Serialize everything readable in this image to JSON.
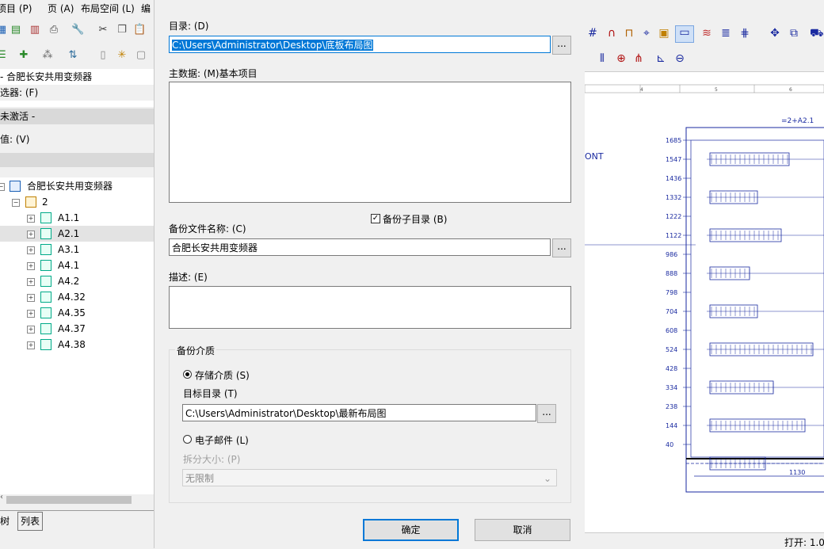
{
  "menu": {
    "items": [
      "项目 (P)",
      "页 (A)",
      "布局空间 (L)",
      "编"
    ]
  },
  "left": {
    "project_row": "- 合肥长安共用变频器",
    "filter_label": "选器: (F)",
    "inactive_label": "未激活 -",
    "value_label": "值: (V)",
    "tree": {
      "root": "合肥长安共用变频器",
      "group": "2",
      "items": [
        "A1.1",
        "A2.1",
        "A3.1",
        "A4.1",
        "A4.2",
        "A4.32",
        "A4.35",
        "A4.37",
        "A4.38"
      ]
    },
    "tabs": [
      "树",
      "列表"
    ]
  },
  "dialog": {
    "dir_label": "目录: (D)",
    "dir_value": "C:\\Users\\Administrator\\Desktop\\底板布局图",
    "master_label": "主数据: (M)基本项目",
    "backup_sub_label": "备份子目录 (B)",
    "backup_sub_checked": true,
    "file_name_label": "备份文件名称: (C)",
    "file_name_value": "合肥长安共用变频器",
    "desc_label": "描述: (E)",
    "media_group_label": "备份介质",
    "storage_label": "存储介质 (S)",
    "storage_selected": true,
    "target_dir_label": "目标目录 (T)",
    "target_dir_value": "C:\\Users\\Administrator\\Desktop\\最新布局图",
    "email_label": "电子邮件 (L)",
    "split_label": "拆分大小: (P)",
    "split_value": "无限制",
    "browse": "...",
    "ok_label": "确定",
    "cancel_label": "取消"
  },
  "drawing": {
    "title": "=2+A2.1",
    "side_text": "ONT",
    "ruler": [
      "4",
      "5",
      "6"
    ],
    "dims": [
      "1685",
      "1547",
      "1436",
      "1332",
      "1222",
      "1122",
      "986",
      "888",
      "798",
      "704",
      "608",
      "524",
      "428",
      "334",
      "238",
      "144",
      "40"
    ],
    "bottom_dim": "1130",
    "status_text": "打开: 1.0"
  }
}
